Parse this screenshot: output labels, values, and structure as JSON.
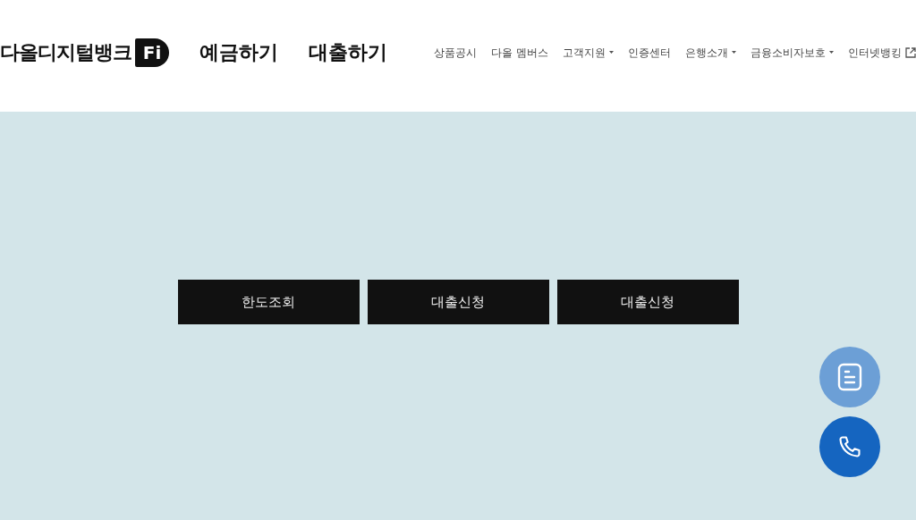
{
  "logo": {
    "text": "다올디지털뱅크",
    "mark": "Fi"
  },
  "main_menu": [
    "예금하기",
    "대출하기"
  ],
  "nav": [
    {
      "label": "상품공시",
      "kind": "link"
    },
    {
      "label": "다올 멤버스",
      "kind": "link"
    },
    {
      "label": "고객지원",
      "kind": "dropdown"
    },
    {
      "label": "인증센터",
      "kind": "link"
    },
    {
      "label": "은행소개",
      "kind": "dropdown"
    },
    {
      "label": "금융소비자보호",
      "kind": "dropdown"
    },
    {
      "label": "인터넷뱅킹",
      "kind": "external"
    }
  ],
  "actions": [
    "한도조회",
    "대출신청",
    "대출신청"
  ],
  "floating_buttons": [
    {
      "kind": "document"
    },
    {
      "kind": "phone"
    }
  ]
}
